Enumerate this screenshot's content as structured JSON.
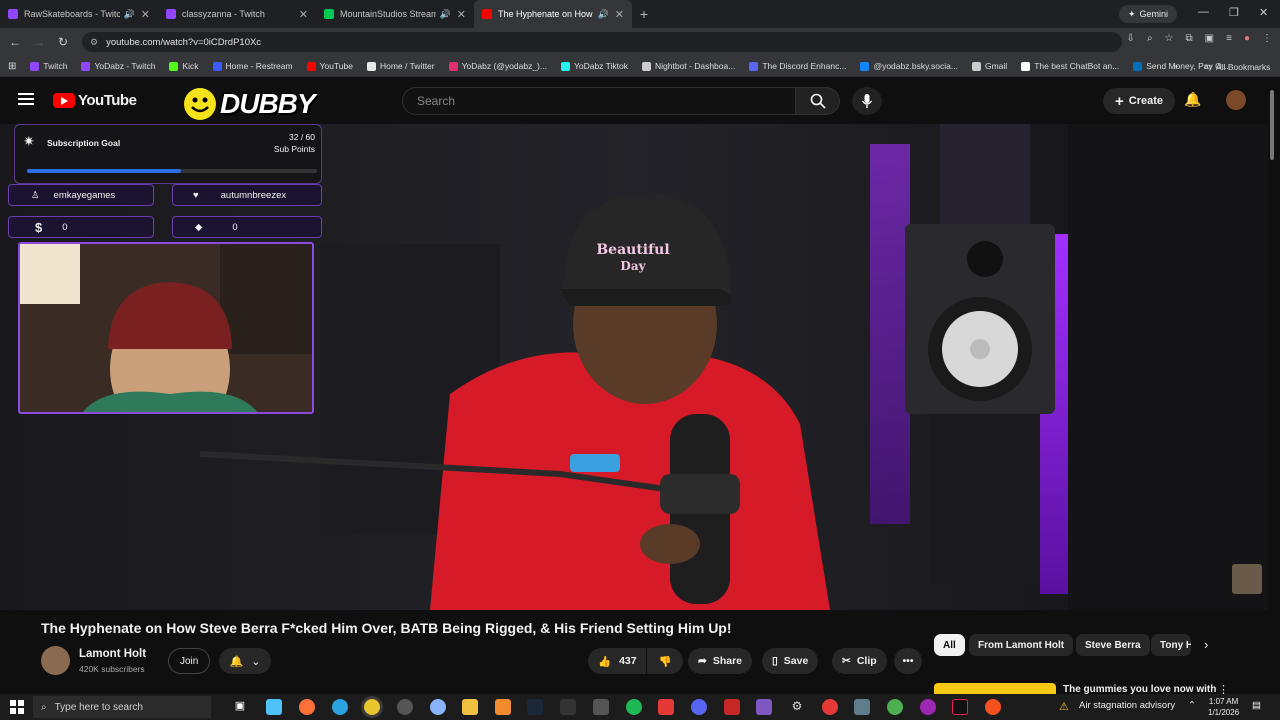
{
  "browser": {
    "tabs": [
      {
        "title": "RawSkateboards - Twitch",
        "color": "#9146ff",
        "audio": true,
        "active": false
      },
      {
        "title": "classyzanna - Twitch",
        "color": "#9146ff",
        "audio": false,
        "active": false
      },
      {
        "title": "MountainStudios Stream - Wat",
        "color": "#00c853",
        "audio": true,
        "active": false
      },
      {
        "title": "The Hyphenate on How Ste",
        "color": "#ff0000",
        "audio": true,
        "active": true
      }
    ],
    "gemini_label": "Gemini",
    "url": "youtube.com/watch?v=0iCDrdP10Xc",
    "bookmarks": [
      {
        "label": "Twitch",
        "color": "#9146ff"
      },
      {
        "label": "YoDabz - Twitch",
        "color": "#9146ff"
      },
      {
        "label": "Kick",
        "color": "#53fc18"
      },
      {
        "label": "Home - Restream",
        "color": "#3b5bff"
      },
      {
        "label": "YouTube",
        "color": "#ff0000"
      },
      {
        "label": "Home / Twitter",
        "color": "#e8e8e8"
      },
      {
        "label": "YoDabz (@yodabz_)...",
        "color": "#e1306c"
      },
      {
        "label": "YoDabz Tiktok",
        "color": "#25f4ee"
      },
      {
        "label": "Nightbot - Dashboa...",
        "color": "#cccccc"
      },
      {
        "label": "The Discord Enhanc...",
        "color": "#5865f2"
      },
      {
        "label": "@yodabz.bsky.socia...",
        "color": "#1185fe"
      },
      {
        "label": "Gmail",
        "color": "#cccccc"
      },
      {
        "label": "The best ChatBot an...",
        "color": "#ffffff"
      },
      {
        "label": "Send Money, Pay O...",
        "color": "#0070ba"
      }
    ],
    "all_bookmarks_label": "All Bookmarks"
  },
  "youtube": {
    "logo_text": "YouTube",
    "channel_badge_text": "DUBBY",
    "search_placeholder": "Search",
    "create_label": "Create"
  },
  "overlay": {
    "goal_title": "Subscription Goal",
    "goal_count": "32 / 60",
    "goal_unit": "Sub Points",
    "goal_progress": 0.53,
    "latest_follower": "emkayegames",
    "latest_sub": "autumnbreezex",
    "donations": "0",
    "bits": "0"
  },
  "video": {
    "title": "The Hyphenate on How Steve Berra F*cked Him Over, BATB Being Rigged, & His Friend Setting Him Up!",
    "channel_name": "Lamont Holt",
    "subscribers": "420K subscribers",
    "join_label": "Join",
    "likes": "437",
    "share_label": "Share",
    "save_label": "Save",
    "clip_label": "Clip"
  },
  "chips": [
    "All",
    "From Lamont Holt",
    "Steve Berra",
    "Tony H"
  ],
  "ad_text": "The gummies you love now with",
  "taskbar": {
    "search_placeholder": "Type here to search",
    "weather_text": "Air stagnation advisory",
    "time": "1:07 AM",
    "date": "1/1/2026"
  }
}
